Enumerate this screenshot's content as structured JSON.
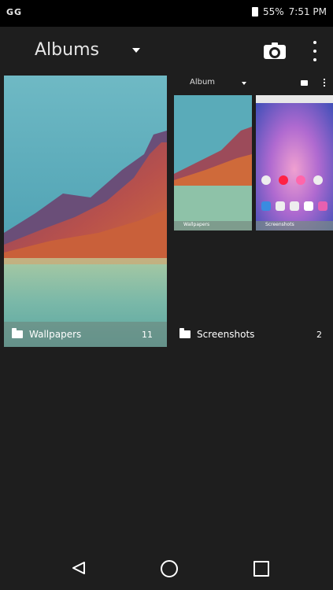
{
  "status_bar": {
    "carrier": "GG",
    "battery_percent": "55%",
    "time": "7:51 PM"
  },
  "app_bar": {
    "album_spinner_label": "Albums"
  },
  "albums": [
    {
      "name": "Wallpapers",
      "count": "11"
    },
    {
      "name": "Screenshots",
      "count": "2"
    }
  ],
  "preview": {
    "label": "Album",
    "albums": [
      {
        "name": "Wallpapers"
      },
      {
        "name": "Screenshots"
      }
    ]
  },
  "icons": {
    "camera": "camera-icon",
    "overflow": "more-vert-icon",
    "folder": "folder-icon",
    "back": "back-icon",
    "home": "home-icon",
    "recents": "recents-icon"
  }
}
